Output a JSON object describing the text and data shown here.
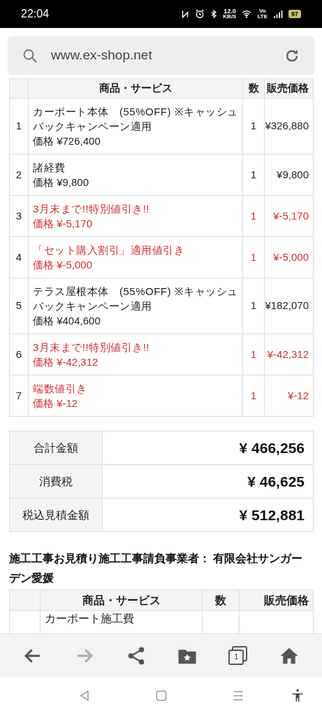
{
  "status_bar": {
    "time": "22:04",
    "network_speed": "12.0",
    "network_unit": "KB/S",
    "volte": "Vo",
    "lte": "LTE",
    "battery": "97"
  },
  "address_bar": {
    "url": "www.ex-shop.net"
  },
  "estimate_table": {
    "columns": [
      "",
      "商品・サービス",
      "数",
      "販売価格"
    ],
    "rows": [
      {
        "kind": "item",
        "no": "1",
        "name": "カーポート本体　(55%OFF) ※キャッシュバックキャンペーン適用",
        "list_price": "価格 ¥726,400",
        "qty": "1",
        "price": "¥326,880"
      },
      {
        "kind": "item",
        "no": "2",
        "name": "諸経費",
        "list_price": "価格 ¥9,800",
        "qty": "1",
        "price": "¥9,800"
      },
      {
        "kind": "discount",
        "no": "3",
        "name": "3月末まで!!特別値引き!!",
        "list_price": "価格 ¥-5,170",
        "qty": "1",
        "price": "¥-5,170"
      },
      {
        "kind": "discount",
        "no": "4",
        "name": "「セット購入割引」適用値引き",
        "list_price": "価格 ¥-5,000",
        "qty": "1",
        "price": "¥-5,000"
      },
      {
        "kind": "item",
        "no": "5",
        "name": "テラス屋根本体　(55%OFF) ※キャッシュバックキャンペーン適用",
        "list_price": "価格 ¥404,600",
        "qty": "1",
        "price": "¥182,070"
      },
      {
        "kind": "discount",
        "no": "6",
        "name": "3月末まで!!特別値引き!!",
        "list_price": "価格 ¥-42,312",
        "qty": "1",
        "price": "¥-42,312"
      },
      {
        "kind": "discount",
        "no": "7",
        "name": "端数値引き",
        "list_price": "価格 ¥-12",
        "qty": "1",
        "price": "¥-12"
      }
    ]
  },
  "totals": [
    {
      "label": "合計金額",
      "value": "¥ 466,256"
    },
    {
      "label": "消費税",
      "value": "¥ 46,625"
    },
    {
      "label": "税込見積金額",
      "value": "¥ 512,881"
    }
  ],
  "construction_heading": "施工工事お見積り施工工事請負事業者： 有限会社サンガーデン愛媛",
  "construction_table": {
    "columns": [
      "",
      "商品・サービス",
      "数",
      "販売価格"
    ],
    "rows": [
      {
        "name": "カーポート施工費"
      }
    ]
  },
  "toolbar": {
    "tab_count": "1",
    "forward_disabled": true
  }
}
